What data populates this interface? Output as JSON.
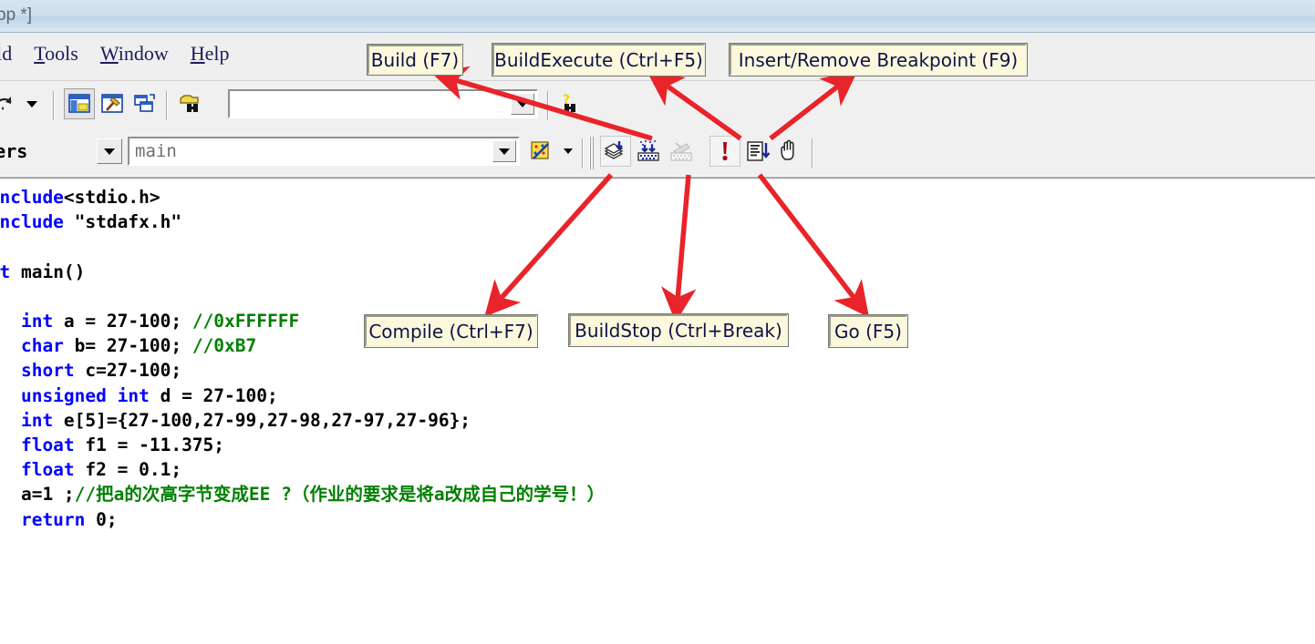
{
  "window": {
    "title_fragment": "pp *]",
    "menus": [
      {
        "name": "build",
        "pre": "",
        "accel": "",
        "post": "ild"
      },
      {
        "name": "tools",
        "pre": "",
        "accel": "T",
        "post": "ools"
      },
      {
        "name": "window",
        "pre": "",
        "accel": "W",
        "post": "indow"
      },
      {
        "name": "help",
        "pre": "",
        "accel": "H",
        "post": "elp"
      }
    ]
  },
  "toolbar_row1": {
    "undo_dropdown_icon": "undo-redo-icon",
    "buttons": [
      {
        "name": "workspace-icon",
        "title": "Workspace"
      },
      {
        "name": "output-window-icon",
        "title": "Output"
      },
      {
        "name": "window-list-icon",
        "title": "Window List"
      },
      {
        "name": "find-in-files-icon",
        "title": "Find in Files"
      }
    ],
    "find_combo_value": "",
    "help_icon": "find-help-icon"
  },
  "toolbar_row2": {
    "members_combo_value": "members",
    "function_combo_value": "main",
    "bookmark_icon": "bookmark-icon",
    "build_buttons": [
      {
        "name": "compile-button",
        "icon": "compile-icon",
        "state": "enabled"
      },
      {
        "name": "build-button",
        "icon": "build-icon",
        "state": "enabled"
      },
      {
        "name": "build-stop-button",
        "icon": "build-stop-icon",
        "state": "disabled"
      },
      {
        "name": "go-button",
        "icon": "exclamation-icon",
        "state": "enabled"
      },
      {
        "name": "execute-program-button",
        "icon": "execute-icon",
        "state": "enabled"
      },
      {
        "name": "insert-remove-breakpoint-button",
        "icon": "hand-icon",
        "state": "enabled"
      }
    ]
  },
  "editor": {
    "code_lines": [
      [
        {
          "t": "#include",
          "c": "kw"
        },
        {
          "t": "<stdio.h>",
          "c": "pl"
        }
      ],
      [
        {
          "t": "#include ",
          "c": "kw"
        },
        {
          "t": "\"stdafx.h\"",
          "c": "pl"
        }
      ],
      [],
      [
        {
          "t": "int ",
          "c": "kw"
        },
        {
          "t": "main()",
          "c": "pl"
        }
      ],
      [
        {
          "t": "{",
          "c": "pl"
        }
      ],
      [
        {
          "t": "    int",
          "c": "kw"
        },
        {
          "t": " a = 27-100; ",
          "c": "pl"
        },
        {
          "t": "//0xFFFFFF",
          "c": "cm"
        }
      ],
      [
        {
          "t": "    char",
          "c": "kw"
        },
        {
          "t": " b= 27-100; ",
          "c": "pl"
        },
        {
          "t": "//0xB7",
          "c": "cm"
        }
      ],
      [
        {
          "t": "    short",
          "c": "kw"
        },
        {
          "t": " c=27-100;",
          "c": "pl"
        }
      ],
      [
        {
          "t": "    unsigned int",
          "c": "kw"
        },
        {
          "t": " d = 27-100;",
          "c": "pl"
        }
      ],
      [
        {
          "t": "    int",
          "c": "kw"
        },
        {
          "t": " e[5]={27-100,27-99,27-98,27-97,27-96};",
          "c": "pl"
        }
      ],
      [
        {
          "t": "    float",
          "c": "kw"
        },
        {
          "t": " f1 = -11.375;",
          "c": "pl"
        }
      ],
      [
        {
          "t": "    float",
          "c": "kw"
        },
        {
          "t": " f2 = 0.1;",
          "c": "pl"
        }
      ],
      [
        {
          "t": "    a=1 ;",
          "c": "pl"
        },
        {
          "t": "//把a的次高字节变成EE ?（作业的要求是将a改成自己的学号！）",
          "c": "cm"
        }
      ],
      [
        {
          "t": "    return",
          "c": "kw"
        },
        {
          "t": " 0;",
          "c": "pl"
        }
      ]
    ]
  },
  "annotations": {
    "accent_color": "#e8242a",
    "callout_bg": "#fbf8dc",
    "callout_text_color": "#12124a",
    "items": [
      {
        "name": "callout-build",
        "label": "Build (F7)"
      },
      {
        "name": "callout-build-execute",
        "label": "BuildExecute (Ctrl+F5)"
      },
      {
        "name": "callout-insert-remove-breakpoint",
        "label": "Insert/Remove Breakpoint (F9)"
      },
      {
        "name": "callout-compile",
        "label": "Compile (Ctrl+F7)"
      },
      {
        "name": "callout-build-stop",
        "label": "BuildStop (Ctrl+Break)"
      },
      {
        "name": "callout-go",
        "label": "Go (F5)"
      }
    ]
  }
}
